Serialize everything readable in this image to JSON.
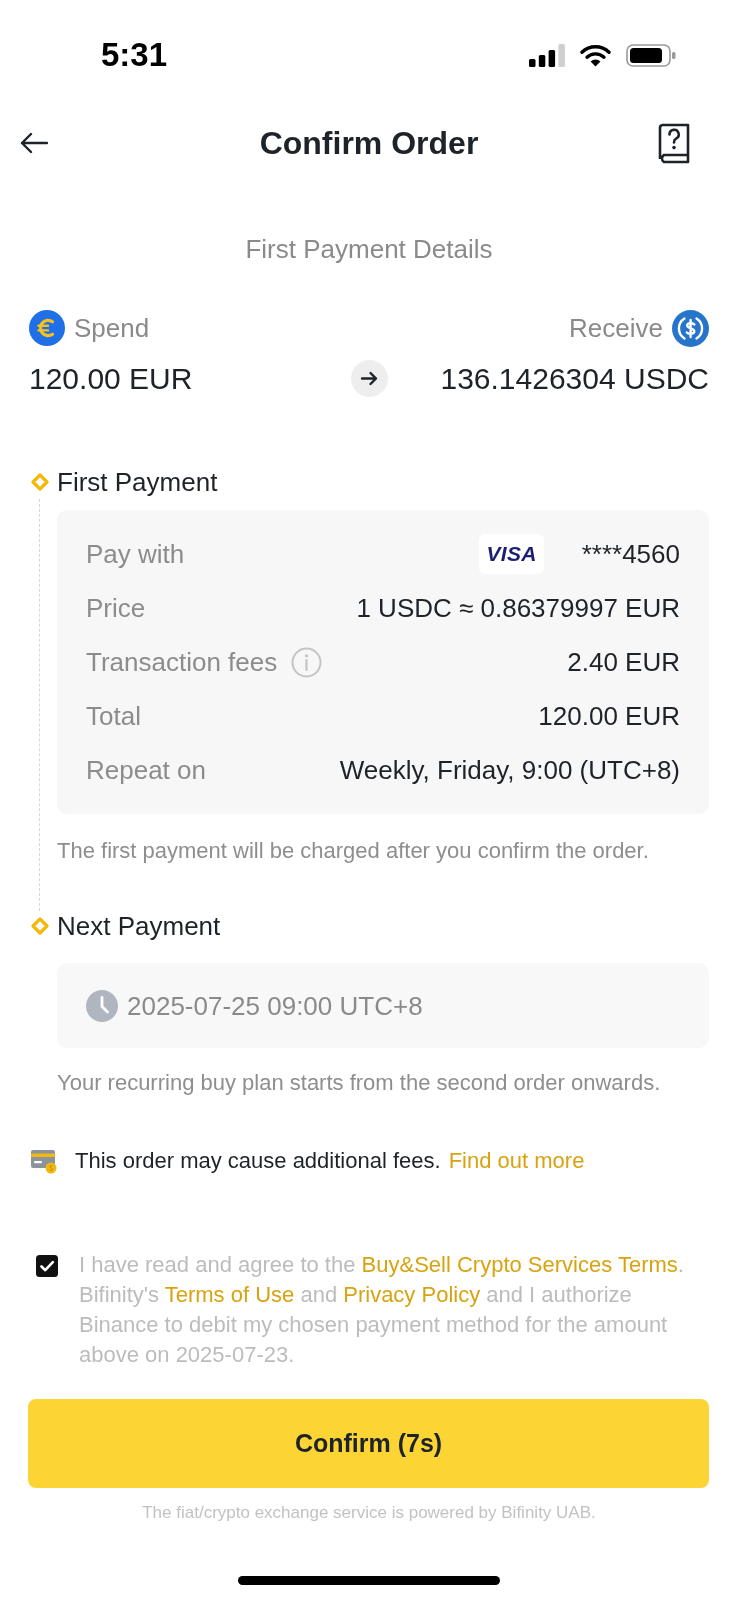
{
  "status_bar": {
    "time": "5:31"
  },
  "header": {
    "title": "Confirm Order"
  },
  "section_title": "First Payment Details",
  "exchange": {
    "spend": {
      "label": "Spend",
      "amount": "120.00 EUR"
    },
    "receive": {
      "label": "Receive",
      "amount": "136.1426304 USDC"
    }
  },
  "steps": [
    {
      "kind": "details",
      "title": "First Payment",
      "rows": [
        {
          "kind": "card",
          "label": "Pay with",
          "brand": "VISA",
          "value": "****4560"
        },
        {
          "kind": "plain",
          "label": "Price",
          "value": "1 USDC ≈ 0.86379997 EUR"
        },
        {
          "kind": "info",
          "label": "Transaction fees",
          "value": "2.40 EUR"
        },
        {
          "kind": "plain",
          "label": "Total",
          "value": "120.00 EUR"
        },
        {
          "kind": "plain",
          "label": "Repeat on",
          "value": "Weekly, Friday, 9:00 (UTC+8)"
        }
      ],
      "note": "The first payment will be charged after you confirm the order."
    },
    {
      "kind": "schedule",
      "title": "Next Payment",
      "time": "2025-07-25 09:00 UTC+8",
      "note": "Your recurring buy plan starts from the second order onwards."
    }
  ],
  "fees_notice": {
    "text": "This order may cause additional fees.",
    "link": "Find out more"
  },
  "terms": {
    "checked": true,
    "parts": [
      {
        "kind": "text",
        "text": "I have read and agree to the "
      },
      {
        "kind": "link",
        "text": "Buy&Sell Crypto Services Terms"
      },
      {
        "kind": "text",
        "text": ". Bifinity's "
      },
      {
        "kind": "link",
        "text": "Terms of Use"
      },
      {
        "kind": "text",
        "text": " and "
      },
      {
        "kind": "link",
        "text": "Privacy Policy"
      },
      {
        "kind": "text",
        "text": " and I authorize Binance to debit my chosen payment method for the amount above on 2025-07-23."
      }
    ]
  },
  "confirm_button": {
    "label": "Confirm (7s)"
  },
  "footer": "The fiat/crypto exchange service is powered by Bifinity UAB."
}
